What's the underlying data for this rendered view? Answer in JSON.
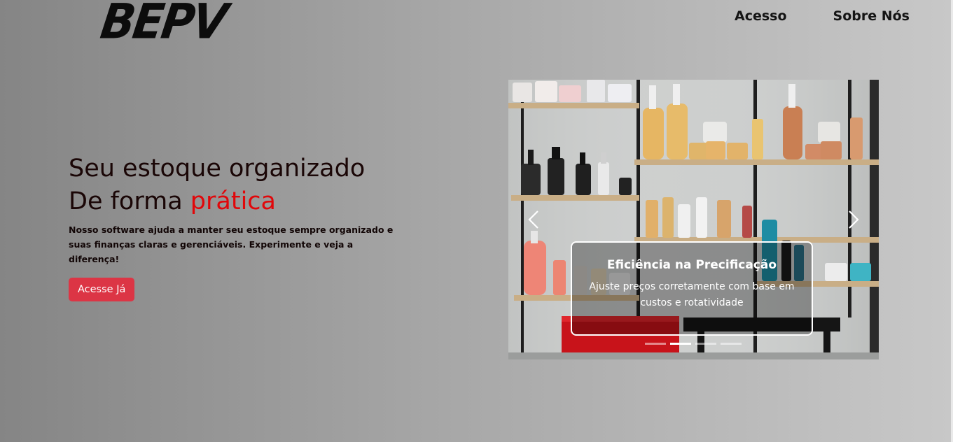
{
  "header": {
    "logo_text": "BEPV",
    "nav": [
      {
        "label": "Acesso"
      },
      {
        "label": "Sobre Nós"
      }
    ]
  },
  "hero": {
    "title_line1": "Seu estoque organizado",
    "title_line2_prefix": "De forma ",
    "title_line2_accent": "prática",
    "description": "Nosso software ajuda a manter seu estoque sempre organizado e suas finanças claras e gerenciáveis. Experimente e veja a diferença!",
    "cta_label": "Acesse Já"
  },
  "carousel": {
    "caption_title": "Eficiência na Precificação",
    "caption_text": "Ajuste preços corretamente com base em custos e rotatividade",
    "prev_icon": "chevron-left-icon",
    "next_icon": "chevron-right-icon",
    "slide_count": 4,
    "active_slide": 2
  },
  "colors": {
    "accent": "#e1070a",
    "cta_background": "#dc3545"
  }
}
